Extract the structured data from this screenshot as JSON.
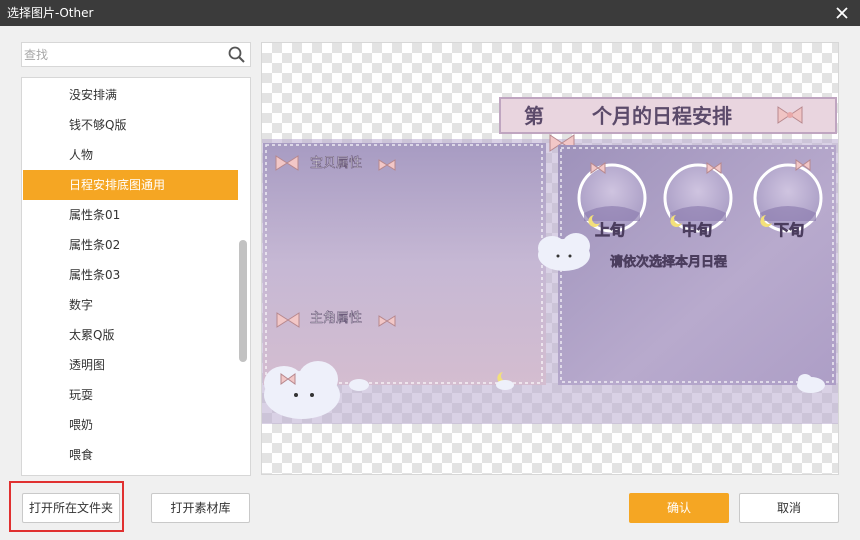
{
  "window": {
    "title": "选择图片-Other"
  },
  "search": {
    "placeholder": "查找",
    "value": ""
  },
  "list": {
    "items": [
      {
        "label": "没安排满",
        "selected": false
      },
      {
        "label": "钱不够Q版",
        "selected": false
      },
      {
        "label": "人物",
        "selected": false
      },
      {
        "label": "日程安排底图通用",
        "selected": true
      },
      {
        "label": "属性条01",
        "selected": false
      },
      {
        "label": "属性条02",
        "selected": false
      },
      {
        "label": "属性条03",
        "selected": false
      },
      {
        "label": "数字",
        "selected": false
      },
      {
        "label": "太累Q版",
        "selected": false
      },
      {
        "label": "透明图",
        "selected": false
      },
      {
        "label": "玩耍",
        "selected": false
      },
      {
        "label": "喂奶",
        "selected": false
      },
      {
        "label": "喂食",
        "selected": false
      }
    ]
  },
  "preview": {
    "banner": {
      "prefix": "第",
      "suffix": "个月的日程安排"
    },
    "panel_left": {
      "label1": "宝贝属性",
      "label2": "主角属性"
    },
    "periods": [
      "上旬",
      "中旬",
      "下旬"
    ],
    "prompt": "请依次选择本月日程"
  },
  "buttons": {
    "open_folder": "打开所在文件夹",
    "open_library": "打开素材库",
    "confirm": "确认",
    "cancel": "取消"
  },
  "colors": {
    "titlebar": "#3b3b3b",
    "accent": "#f5a623",
    "highlight_box": "#e03030",
    "panel_purple": "#a99cc0",
    "banner_pink": "#e6d0dc"
  },
  "icons": [
    "close-icon",
    "search-icon",
    "bow-icon",
    "cloud-icon",
    "moon-icon"
  ]
}
